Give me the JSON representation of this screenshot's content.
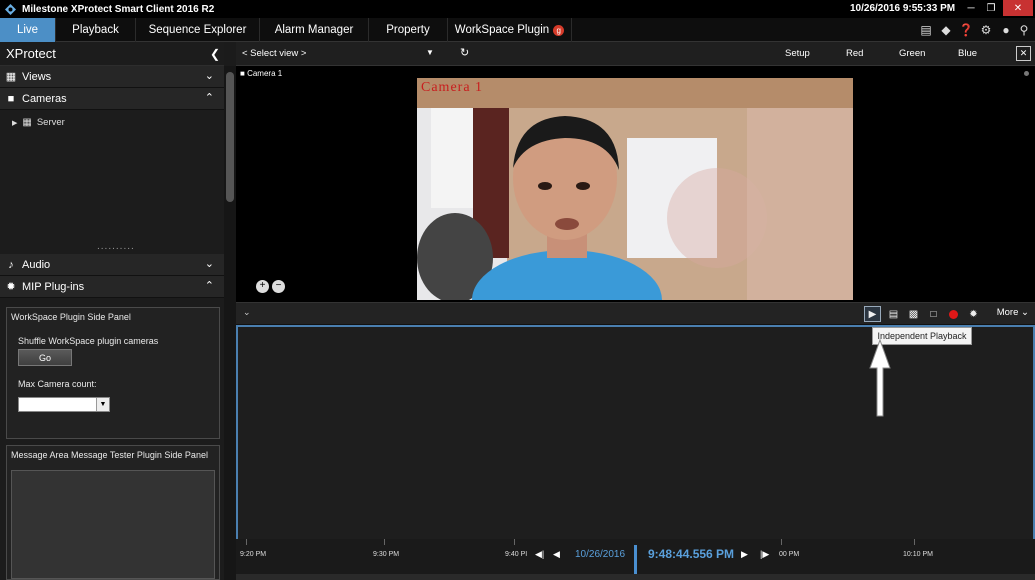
{
  "window": {
    "title": "Milestone XProtect Smart Client 2016 R2",
    "datetime": "10/26/2016 9:55:33 PM",
    "minimize_icon": "minimize-icon",
    "restore_icon": "restore-icon",
    "close_icon": "close-icon"
  },
  "tabs": [
    {
      "label": "Live",
      "active": true
    },
    {
      "label": "Playback"
    },
    {
      "label": "Sequence Explorer"
    },
    {
      "label": "Alarm Manager"
    },
    {
      "label": "Property"
    },
    {
      "label": "WorkSpace Plugin",
      "badge": "g"
    }
  ],
  "toolbar_icons": [
    "monitor-icon",
    "network-icon",
    "help-icon",
    "settings-icon",
    "pin-icon"
  ],
  "left_panel": {
    "title": "XProtect",
    "views_label": "Views",
    "cameras_label": "Cameras",
    "server_label": "Server",
    "drag_handle": "..........",
    "audio_label": "Audio",
    "mip_label": "MIP Plug-ins",
    "workspace_panel": {
      "title": "WorkSpace Plugin Side Panel",
      "shuffle_label": "Shuffle WorkSpace plugin cameras",
      "go_button": "Go",
      "max_count_label": "Max Camera count:",
      "max_count_value": ""
    },
    "message_panel_title": "Message Area Message Tester Plugin Side Panel"
  },
  "view_toolbar": {
    "select_view": "< Select view >",
    "setup": "Setup",
    "red": "Red",
    "green": "Green",
    "blue": "Blue"
  },
  "camera": {
    "label": "Camera 1",
    "overlay": "Camera 1"
  },
  "camera_toolbar": {
    "more": "More",
    "tooltip": "Independent Playback"
  },
  "timeline": {
    "labels": [
      "9:20 PM",
      "9:30 PM",
      "9:40 PI",
      "00 PM",
      "10:10 PM"
    ],
    "date": "10/26/2016",
    "current_time": "9:48:44.556 PM"
  },
  "colors": {
    "accent": "#4c8fc6",
    "timeline_text": "#5aa0dc",
    "record": "#e01818"
  }
}
